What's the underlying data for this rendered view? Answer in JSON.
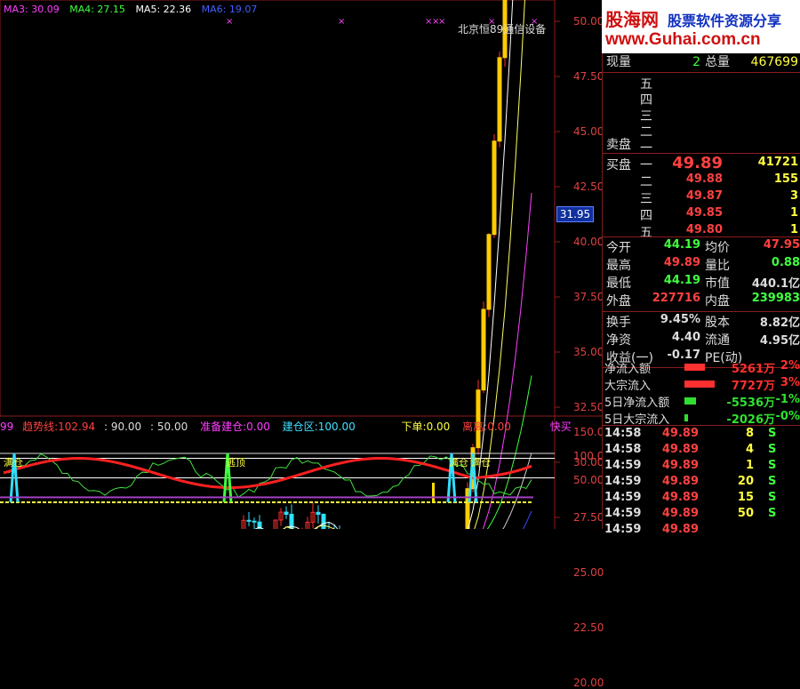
{
  "legend": {
    "ma3": "MA3: 30.09",
    "ma4": "MA4: 27.15",
    "ma5": "MA5: 22.36",
    "ma6": "MA6: 19.07",
    "ma3_color": "#ff40ff",
    "ma4_color": "#40ff40",
    "ma5_color": "#ffffff",
    "ma6_color": "#4060ff"
  },
  "broker_text": "北京恒89通信设备",
  "price_axis": [
    "50.00",
    "47.50",
    "45.00",
    "42.50",
    "40.00",
    "37.50",
    "35.00",
    "32.50",
    "30.00",
    "27.50",
    "25.00",
    "22.50",
    "20.00"
  ],
  "current_price_tag": "31.95",
  "indicator_bar": {
    "p0": "99",
    "trend_label": "趋势线:",
    "trend_value": "102.94",
    "v90": ": 90.00",
    "v50": ": 50.00",
    "prep_label": "准备建仓:",
    "prep_value": "0.00",
    "build_label": "建仓区:",
    "build_value": "100.00",
    "down_label": "下单:",
    "down_value": "0.00",
    "leave_label": "离离:",
    "leave_value": "0.00",
    "fast_label": "快买"
  },
  "indicator_axis": [
    "150.00",
    "100.00",
    "50.00"
  ],
  "indicator_marks": {
    "m1": "满仓",
    "m2": "逃顶",
    "m3": "满仓",
    "m4": "满仓"
  },
  "logo": {
    "cn": "股海网",
    "slogan": "股票软件资源分享",
    "url": "www.Guhai.com.cn"
  },
  "quote": {
    "xianliang_label": "现量",
    "xianliang_value": "2",
    "zongliang_label": "总量",
    "zongliang_value": "467699",
    "sell_levels": [
      "五",
      "四",
      "三",
      "二",
      "一"
    ],
    "sell_label": "卖盘",
    "buy_label": "买盘",
    "buy_levels": [
      {
        "lvl": "一",
        "price": "49.89",
        "vol": "41721"
      },
      {
        "lvl": "二",
        "price": "49.88",
        "vol": "155"
      },
      {
        "lvl": "三",
        "price": "49.87",
        "vol": "3"
      },
      {
        "lvl": "四",
        "price": "49.85",
        "vol": "1"
      },
      {
        "lvl": "五",
        "price": "49.80",
        "vol": "1"
      }
    ],
    "stats": [
      {
        "l1": "今开",
        "v1": "44.19",
        "l2": "均价",
        "v2": "47.95",
        "c1": "#40ff40",
        "c2": "#ff4040"
      },
      {
        "l1": "最高",
        "v1": "49.89",
        "l2": "量比",
        "v2": "0.88",
        "c1": "#ff4040",
        "c2": "#40ff40"
      },
      {
        "l1": "最低",
        "v1": "44.19",
        "l2": "市值",
        "v2": "440.1亿",
        "c1": "#40ff40",
        "c2": "#dddddd"
      },
      {
        "l1": "外盘",
        "v1": "227716",
        "l2": "内盘",
        "v2": "239983",
        "c1": "#ff4040",
        "c2": "#40ff40"
      }
    ],
    "fin": [
      {
        "l1": "换手",
        "v1": "9.45%",
        "l2": "股本",
        "v2": "8.82亿"
      },
      {
        "l1": "净资",
        "v1": "4.40",
        "l2": "流通",
        "v2": "4.95亿"
      },
      {
        "l1": "收益(一)",
        "v1": "-0.17",
        "l2": "PE(动)",
        "v2": ""
      }
    ],
    "flows": [
      {
        "label": "净流入额",
        "val": "5261万",
        "pct": "2%",
        "color": "#ff3030",
        "bar": 38
      },
      {
        "label": "大宗流入",
        "val": "7727万",
        "pct": "3%",
        "color": "#ff3030",
        "bar": 56
      },
      {
        "label": "5日净流入额",
        "val": "-5536万",
        "pct": "-1%",
        "color": "#30e030",
        "bar": 22
      },
      {
        "label": "5日大宗流入",
        "val": "-2026万",
        "pct": "-0%",
        "color": "#30e030",
        "bar": 6
      }
    ],
    "ticks": [
      {
        "time": "14:58",
        "price": "49.89",
        "vol": "8",
        "side": "S"
      },
      {
        "time": "14:58",
        "price": "49.89",
        "vol": "4",
        "side": "S"
      },
      {
        "time": "14:59",
        "price": "49.89",
        "vol": "1",
        "side": "S"
      },
      {
        "time": "14:59",
        "price": "49.89",
        "vol": "20",
        "side": "S"
      },
      {
        "time": "14:59",
        "price": "49.89",
        "vol": "15",
        "side": "S"
      },
      {
        "time": "14:59",
        "price": "49.89",
        "vol": "50",
        "side": "S"
      },
      {
        "time": "14:59",
        "price": "49.89",
        "vol": "",
        "side": ""
      }
    ]
  }
}
